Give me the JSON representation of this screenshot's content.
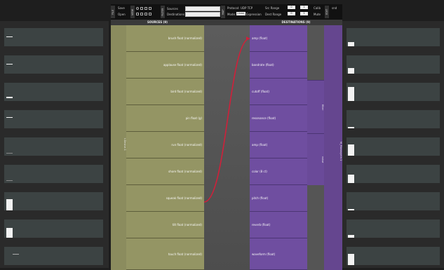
{
  "toolbar": {
    "tag_file": "FILE",
    "tag_view": "VIEW",
    "tag_filter": "FILTER",
    "tag_map": "MAP",
    "tag_edit": "EDIT",
    "save_label": "Save",
    "open_label": "Open",
    "sources_label": "Sources",
    "destinations_label": "Destinations",
    "protocol_label": "Protocol:",
    "protocol_value": "UDP TCP",
    "mode_label": "Mode:",
    "mode_options": [
      "Linear",
      "Expression"
    ],
    "src_range_label": "Src Range",
    "dst_range_label": "Dest Range",
    "src_range": [
      "0",
      "1"
    ],
    "dst_range": [
      "0",
      "1"
    ],
    "calib_label": "Calib",
    "mute_label": "Mute",
    "snd_label": "snd"
  },
  "center": {
    "sources_header": "SOURCES (9)",
    "destinations_header": "DESTINATIONS (9)",
    "source_device_label": "t.Device.1",
    "sources": [
      "brush float (normalized)",
      "applause float (normalized)",
      "bird float (normalized)",
      "pin float (g)",
      "run float (normalized)",
      "shore float (normalized)",
      "squeak float (normalized)",
      "tilt float (normalized)",
      "touch float (normalized)"
    ],
    "destinations": [
      "amp (float)",
      "bandrate (float)",
      "cutoff (float)",
      "resonance (float)",
      "amp (float)",
      "color (8 ct)",
      "pitch (float)",
      "reverb (float)",
      "waveform (float)"
    ],
    "destination_group_filter": "filter",
    "destination_group_noise": "noise",
    "destination_device_label": "M_Monosynth.1"
  },
  "connection": {
    "from_source_index": 6,
    "to_destination_index": 0,
    "color": "#d0203a"
  }
}
